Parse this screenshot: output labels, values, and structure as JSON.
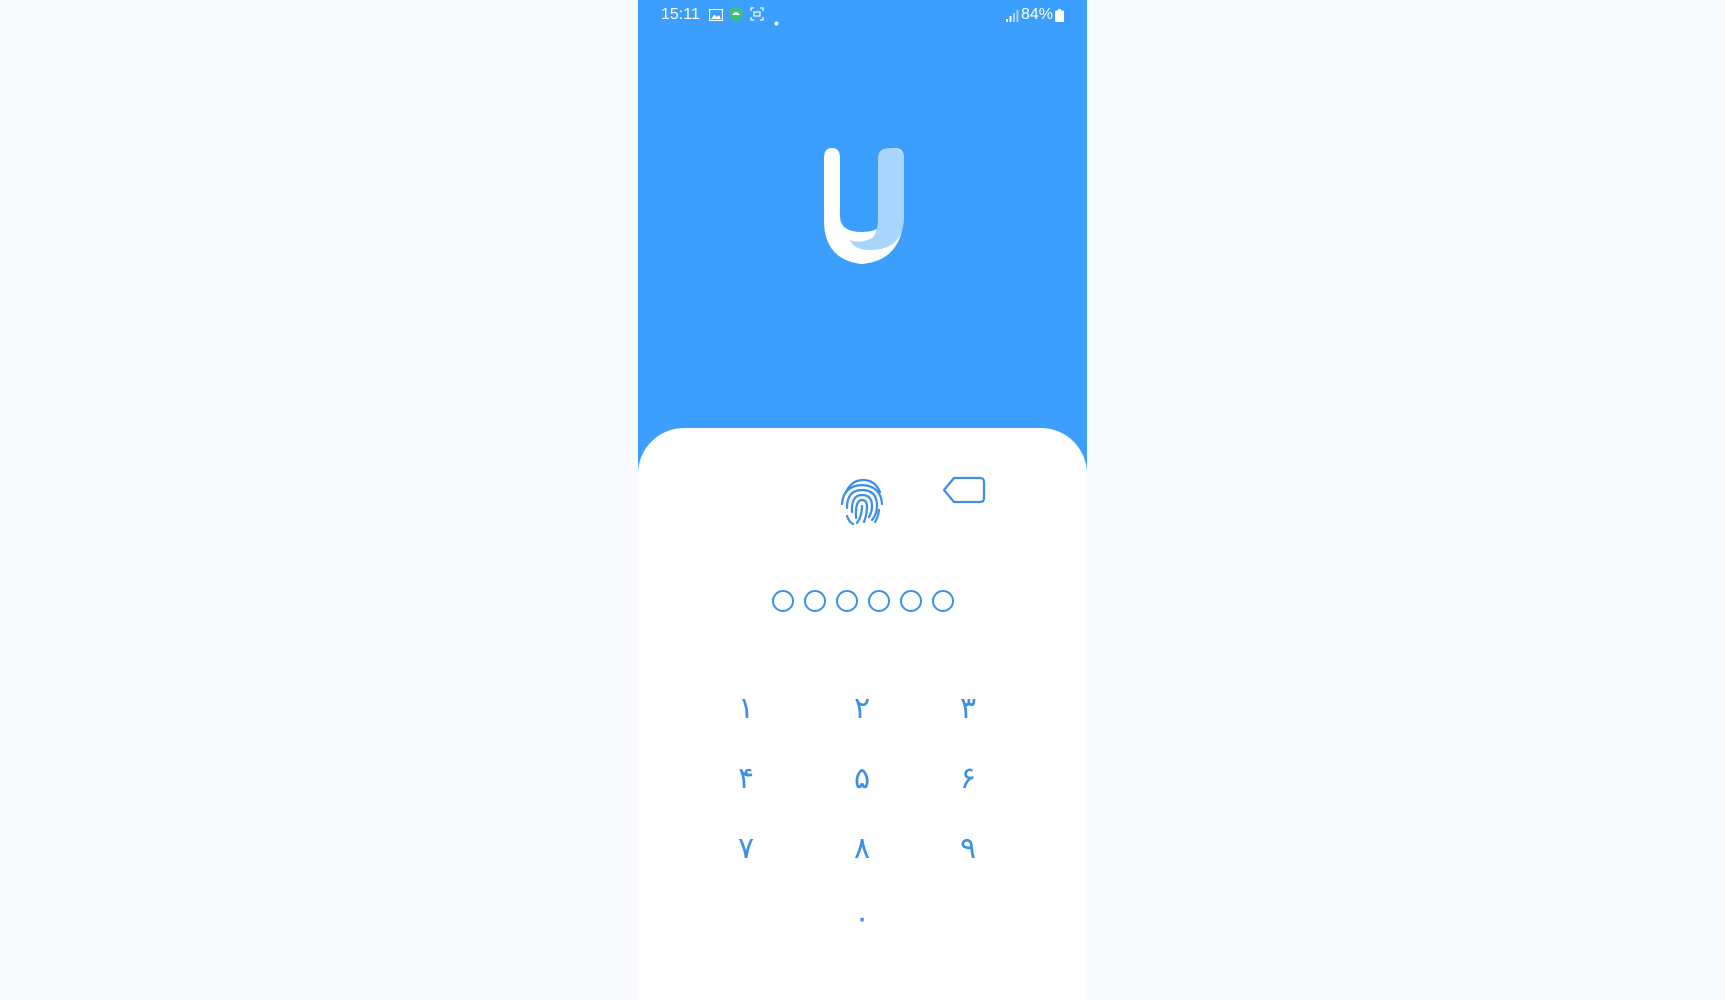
{
  "status_bar": {
    "time": "15:11",
    "battery": "84%",
    "icons": [
      "gallery-icon",
      "app-notification-icon",
      "screenshot-icon",
      "dot-icon",
      "signal-icon",
      "battery-icon"
    ]
  },
  "app": {
    "logo_icon": "u-logo-icon",
    "fingerprint_icon": "fingerprint-icon",
    "backspace_icon": "backspace-icon"
  },
  "pin": {
    "length": 6,
    "filled": 0
  },
  "keypad": {
    "keys": [
      "۱",
      "۲",
      "۳",
      "۴",
      "۵",
      "۶",
      "۷",
      "۸",
      "۹",
      "۰"
    ]
  },
  "colors": {
    "primary_blue": "#3d9ffd",
    "accent_blue": "#3c8fe7",
    "logo_light_blue": "#a9d4fb",
    "panel": "#ffffff",
    "page_bg": "#f8fafd"
  }
}
